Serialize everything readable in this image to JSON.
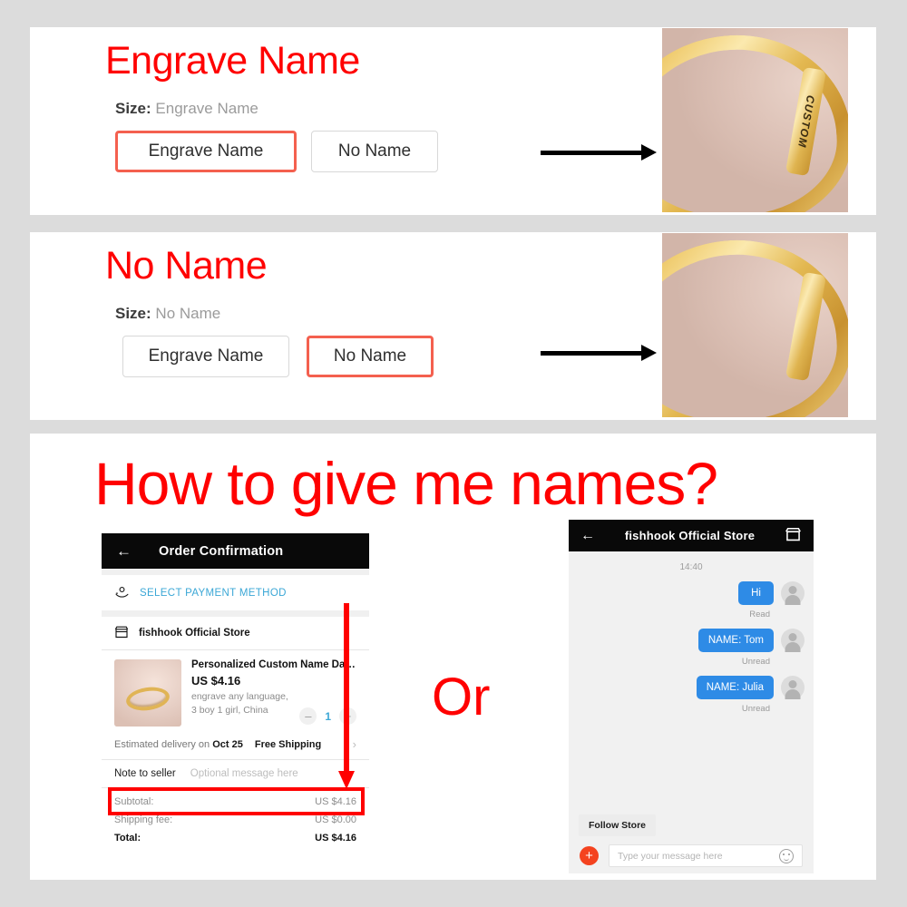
{
  "background_color": "#dcdcdc",
  "accent_red": "#ff0000",
  "option_panels": [
    {
      "heading": "Engrave Name",
      "size_label": "Size:",
      "size_value": "Engrave Name",
      "buttons": [
        {
          "label": "Engrave Name",
          "selected": true
        },
        {
          "label": "No Name",
          "selected": false
        }
      ],
      "photo": {
        "engraving_text": "CUSTOM",
        "has_engraving": true
      }
    },
    {
      "heading": "No Name",
      "size_label": "Size:",
      "size_value": "No Name",
      "buttons": [
        {
          "label": "Engrave Name",
          "selected": false
        },
        {
          "label": "No Name",
          "selected": true
        }
      ],
      "photo": {
        "engraving_text": "",
        "has_engraving": false
      }
    }
  ],
  "howto": {
    "heading": "How to give me  names?",
    "or_text": "Or"
  },
  "order_phone": {
    "back_icon": "arrow-left-icon",
    "title": "Order Confirmation",
    "payment": {
      "icon": "payment-icon",
      "label": "SELECT PAYMENT METHOD"
    },
    "store": {
      "icon": "store-icon",
      "name": "fishhook Official Store"
    },
    "product": {
      "title": "Personalized Custom Name Date ...",
      "price": "US $4.16",
      "attributes": "engrave any language,\n3 boy 1 girl, China",
      "attr_line1": "engrave any language,",
      "attr_line2": "3 boy 1 girl, China",
      "qty_minus": "–",
      "qty_value": "1",
      "qty_plus": "+"
    },
    "shipping": {
      "prefix": "Estimated delivery on",
      "date": "Oct 25",
      "free": "Free Shipping",
      "chevron": "chevron-right-icon"
    },
    "note": {
      "label": "Note to seller",
      "placeholder": "Optional message here"
    },
    "totals": [
      {
        "label": "Subtotal:",
        "value": "US $4.16",
        "strong": false
      },
      {
        "label": "Shipping fee:",
        "value": "US $0.00",
        "strong": false
      },
      {
        "label": "Total:",
        "value": "US $4.16",
        "strong": true
      }
    ]
  },
  "chat_phone": {
    "back_icon": "arrow-left-icon",
    "title": "fishhook Official Store",
    "store_icon": "store-icon",
    "timestamp": "14:40",
    "messages": [
      {
        "text": "Hi",
        "status": "Read"
      },
      {
        "text": "NAME: Tom",
        "status": "Unread"
      },
      {
        "text": "NAME: Julia",
        "status": "Unread"
      }
    ],
    "follow_button": "Follow Store",
    "plus_icon": "plus-icon",
    "input_placeholder": "Type your message here",
    "emoji_icon": "smiley-icon",
    "bubble_color": "#2e8be6"
  }
}
